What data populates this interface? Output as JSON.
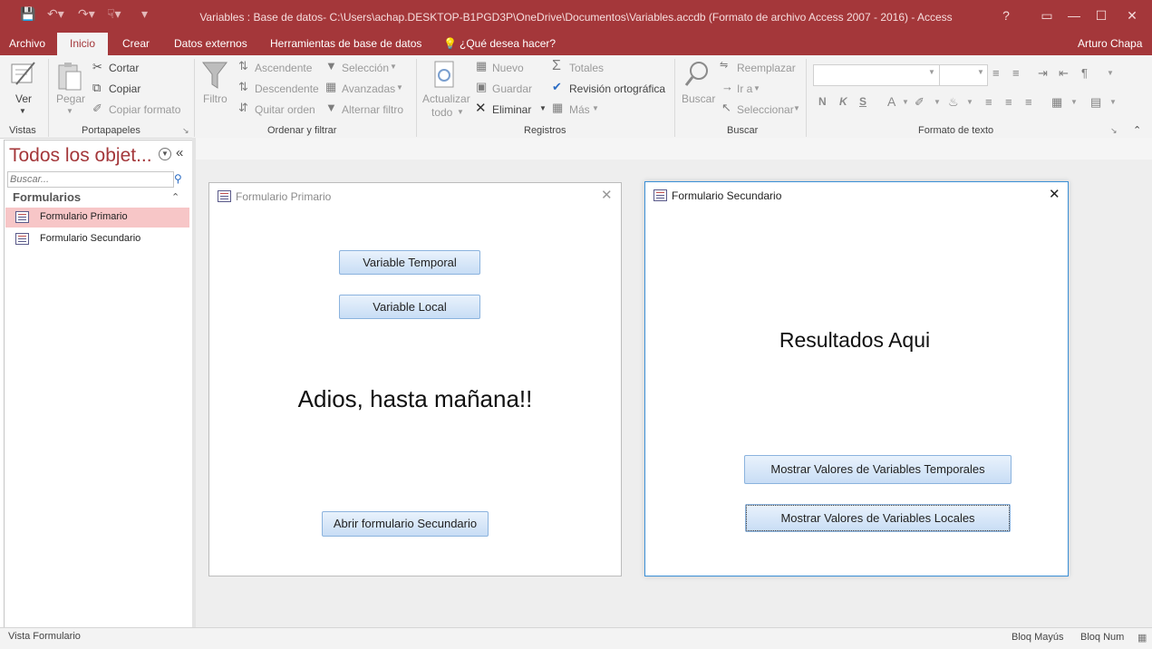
{
  "window": {
    "title": "Variables : Base de datos- C:\\Users\\achap.DESKTOP-B1PGD3P\\OneDrive\\Documentos\\Variables.accdb (Formato de archivo Access 2007 - 2016) - Access",
    "help": "?"
  },
  "tabs": {
    "archivo": "Archivo",
    "inicio": "Inicio",
    "crear": "Crear",
    "datos_externos": "Datos externos",
    "herramientas": "Herramientas de base de datos",
    "tell_me": "¿Qué desea hacer?",
    "user": "Arturo Chapa"
  },
  "ribbon": {
    "vistas": {
      "ver": "Ver",
      "group": "Vistas"
    },
    "portapapeles": {
      "pegar": "Pegar",
      "cortar": "Cortar",
      "copiar": "Copiar",
      "copiar_formato": "Copiar formato",
      "group": "Portapapeles"
    },
    "ordenar": {
      "filtro": "Filtro",
      "ascendente": "Ascendente",
      "descendente": "Descendente",
      "quitar_orden": "Quitar orden",
      "seleccion": "Selección",
      "avanzadas": "Avanzadas",
      "alternar_filtro": "Alternar filtro",
      "group": "Ordenar y filtrar"
    },
    "registros": {
      "actualizar": "Actualizar",
      "todo": "todo",
      "nuevo": "Nuevo",
      "guardar": "Guardar",
      "eliminar": "Eliminar",
      "totales": "Totales",
      "revision": "Revisión ortográfica",
      "mas": "Más",
      "group": "Registros"
    },
    "buscar": {
      "buscar": "Buscar",
      "reemplazar": "Reemplazar",
      "ir_a": "Ir a",
      "seleccionar": "Seleccionar",
      "group": "Buscar"
    },
    "formato": {
      "bold": "N",
      "italic": "K",
      "underline": "S",
      "font_color": "A",
      "group": "Formato de texto"
    }
  },
  "nav": {
    "title": "Todos los objet...",
    "search_placeholder": "Buscar...",
    "section": "Formularios",
    "items": [
      {
        "label": "Formulario Primario",
        "selected": true
      },
      {
        "label": "Formulario Secundario",
        "selected": false
      }
    ]
  },
  "form_primario": {
    "title": "Formulario Primario",
    "btn_temporal": "Variable Temporal",
    "btn_local": "Variable Local",
    "message": "Adios, hasta mañana!!",
    "btn_abrir": "Abrir formulario Secundario"
  },
  "form_secundario": {
    "title": "Formulario Secundario",
    "resultados": "Resultados Aqui",
    "btn_temporales": "Mostrar Valores de Variables Temporales",
    "btn_locales": "Mostrar Valores de Variables Locales"
  },
  "status": {
    "view": "Vista Formulario",
    "caps": "Bloq Mayús",
    "num": "Bloq Num"
  },
  "colors": {
    "accent": "#a4373a",
    "selected_item": "#f7c6c7",
    "button_border": "#8bb3de"
  }
}
